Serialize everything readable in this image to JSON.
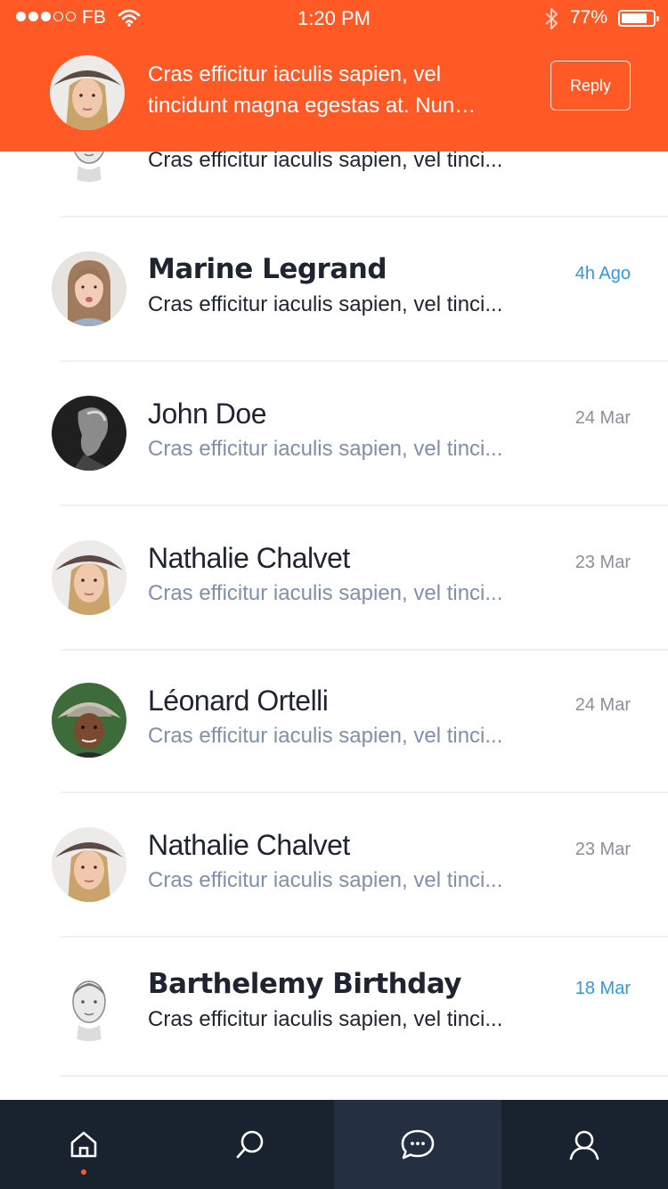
{
  "status_bar": {
    "carrier": "FB",
    "time": "1:20 PM",
    "battery_percent": "77%",
    "signal_bars_filled": 3,
    "signal_bars_total": 5
  },
  "notification": {
    "message": "Cras efficitur iaculis sapien, vel tincidunt magna egestas at. Nun…",
    "reply_label": "Reply",
    "background_color": "#ff5a26"
  },
  "conversations": [
    {
      "name": "",
      "preview": "Cras efficitur iaculis sapien, vel tinci...",
      "date": "",
      "unread": true,
      "avatar": "man-sketch"
    },
    {
      "name": "Marine Legrand",
      "preview": "Cras efficitur iaculis sapien, vel tinci...",
      "date": "4h Ago",
      "unread": true,
      "avatar": "woman-kiss"
    },
    {
      "name": "John Doe",
      "preview": "Cras efficitur iaculis sapien, vel tinci...",
      "date": "24 Mar",
      "unread": false,
      "avatar": "man-dark"
    },
    {
      "name": "Nathalie Chalvet",
      "preview": "Cras efficitur iaculis sapien, vel tinci...",
      "date": "23 Mar",
      "unread": false,
      "avatar": "woman-hat"
    },
    {
      "name": "Léonard Ortelli",
      "preview": "Cras efficitur iaculis sapien, vel tinci...",
      "date": "24 Mar",
      "unread": false,
      "avatar": "old-man-hat"
    },
    {
      "name": "Nathalie Chalvet",
      "preview": "Cras efficitur iaculis sapien, vel tinci...",
      "date": "23 Mar",
      "unread": false,
      "avatar": "woman-hat"
    },
    {
      "name": "Barthelemy Birthday",
      "preview": "Cras efficitur iaculis sapien, vel tinci...",
      "date": "18 Mar",
      "unread": true,
      "avatar": "man-sketch"
    }
  ],
  "tabbar": {
    "items": [
      {
        "icon": "home-icon",
        "active": false,
        "badge": true
      },
      {
        "icon": "search-icon",
        "active": false,
        "badge": false
      },
      {
        "icon": "chat-icon",
        "active": true,
        "badge": false
      },
      {
        "icon": "profile-icon",
        "active": false,
        "badge": false
      }
    ]
  },
  "colors": {
    "accent": "#ff5a26",
    "unread_date": "#2b9be0",
    "read_preview": "#7f8fac",
    "tabbar_bg": "#19222f"
  }
}
